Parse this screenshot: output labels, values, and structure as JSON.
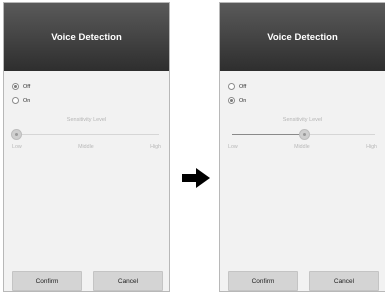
{
  "screens": [
    {
      "title": "Voice Detection",
      "options": [
        {
          "label": "Off",
          "selected": true
        },
        {
          "label": "On",
          "selected": false
        }
      ],
      "sensitivity": {
        "label": "Sensitivity Level",
        "ticks": [
          "Low",
          "Middle",
          "High"
        ],
        "value": 0
      },
      "buttons": {
        "confirm": "Confirm",
        "cancel": "Cancel"
      }
    },
    {
      "title": "Voice Detection",
      "options": [
        {
          "label": "Off",
          "selected": false
        },
        {
          "label": "On",
          "selected": true
        }
      ],
      "sensitivity": {
        "label": "Sensitivity Level",
        "ticks": [
          "Low",
          "Middle",
          "High"
        ],
        "value": 0.5
      },
      "buttons": {
        "confirm": "Confirm",
        "cancel": "Cancel"
      }
    }
  ],
  "arrow_icon": "arrow-right-icon",
  "colors": {
    "title_bar": "#3c3c3c",
    "screen_bg": "#f2f2f2",
    "button_bg": "#d4d4d4"
  }
}
